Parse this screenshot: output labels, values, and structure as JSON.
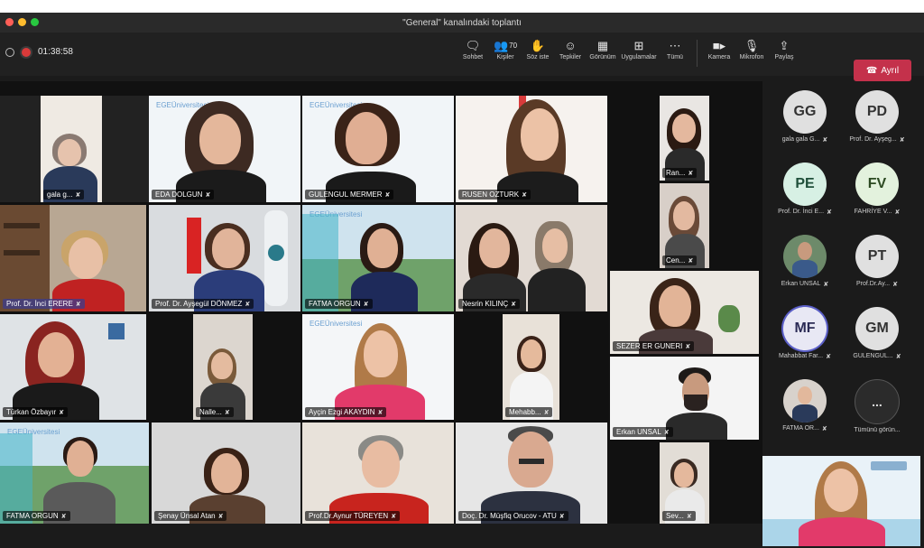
{
  "window": {
    "title": "\"General\" kanalındaki toplantı"
  },
  "toolbar": {
    "timer": "01:38:58",
    "items": [
      {
        "label": "Sohbet",
        "icon": "chat-icon"
      },
      {
        "label": "Kişiler",
        "icon": "people-icon",
        "count": "70"
      },
      {
        "label": "Söz iste",
        "icon": "raise-hand-icon"
      },
      {
        "label": "Tepkiler",
        "icon": "reactions-icon"
      },
      {
        "label": "Görünüm",
        "icon": "view-icon"
      },
      {
        "label": "Uygulamalar",
        "icon": "apps-icon"
      },
      {
        "label": "Tümü",
        "icon": "more-icon"
      },
      {
        "label": "Kamera",
        "icon": "camera-icon"
      },
      {
        "label": "Mikrofon",
        "icon": "mic-icon"
      },
      {
        "label": "Paylaş",
        "icon": "share-icon"
      }
    ],
    "leave_label": "Ayrıl",
    "leave_color": "#c4314b"
  },
  "tiles": [
    {
      "name": "gala g..."
    },
    {
      "name": "EDA DOLGUN"
    },
    {
      "name": "GULENGUL MERMER"
    },
    {
      "name": "RUSEN OZTURK"
    },
    {
      "name": "Ran..."
    },
    {
      "name": "Prof. Dr. İnci ERERE"
    },
    {
      "name": "Prof. Dr. Ayşegül DÖNMEZ"
    },
    {
      "name": "FATMA ORGUN"
    },
    {
      "name": "Nesrin KILINÇ"
    },
    {
      "name": "Cen..."
    },
    {
      "name": "Türkan Özbayır"
    },
    {
      "name": "Nalle..."
    },
    {
      "name": "Ayçin Ezgi AKAYDIN"
    },
    {
      "name": "Mehabb..."
    },
    {
      "name": "SEZER ER GUNERI"
    },
    {
      "name": "Erkan UNSAL"
    },
    {
      "name": "FATMA ORGUN"
    },
    {
      "name": "Şenay Ünsal Atan"
    },
    {
      "name": "Prof.Dr.Aynur TÜREYEN"
    },
    {
      "name": "Doç. Dr. Müşfiq Orucov - ATU"
    },
    {
      "name": "Sev..."
    }
  ],
  "roster": [
    {
      "initials": "GG",
      "label": "gala gala G..."
    },
    {
      "initials": "PD",
      "label": "Prof. Dr. Ayşeg..."
    },
    {
      "initials": "PE",
      "label": "Prof. Dr. İnci E..."
    },
    {
      "initials": "FV",
      "label": "FAHRİYE V..."
    },
    {
      "initials": "",
      "label": "Erkan UNSAL"
    },
    {
      "initials": "PT",
      "label": "Prof.Dr.Ay..."
    },
    {
      "initials": "MF",
      "label": "Mahabbat Far..."
    },
    {
      "initials": "GM",
      "label": "GULENGUL..."
    },
    {
      "initials": "",
      "label": "FATMA OR..."
    },
    {
      "initials": "...",
      "label": "Tümünü görün..."
    }
  ],
  "brand": {
    "ege_name": "EGE",
    "ege_sub": "Üniversitesi"
  }
}
